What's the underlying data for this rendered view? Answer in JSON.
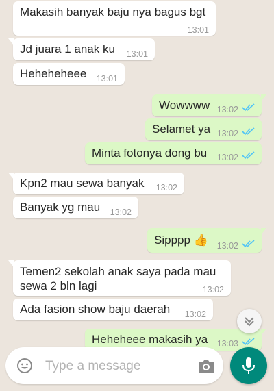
{
  "messages": [
    {
      "dir": "in",
      "text": "Makasih banyak baju nya bagus bgt",
      "time": "13:01"
    },
    {
      "dir": "in",
      "text": "Jd juara 1 anak ku",
      "time": "13:01"
    },
    {
      "dir": "in",
      "text": "Heheheheee",
      "time": "13:01"
    },
    {
      "dir": "out",
      "text": "Wowwww",
      "time": "13:02",
      "status": "read"
    },
    {
      "dir": "out",
      "text": "Selamet ya",
      "time": "13:02",
      "status": "read"
    },
    {
      "dir": "out",
      "text": "Minta fotonya dong bu",
      "time": "13:02",
      "status": "read"
    },
    {
      "dir": "in",
      "text": "Kpn2 mau sewa banyak",
      "time": "13:02"
    },
    {
      "dir": "in",
      "text": "Banyak yg mau",
      "time": "13:02"
    },
    {
      "dir": "out",
      "text": "Sipppp 👍",
      "time": "13:02",
      "status": "read"
    },
    {
      "dir": "in",
      "text": "Temen2 sekolah anak saya pada mau sewa 2 bln lagi",
      "time": "13:02"
    },
    {
      "dir": "in",
      "text": "Ada fasion show baju daerah",
      "time": "13:02"
    },
    {
      "dir": "out",
      "text": "Heheheee makasih ya",
      "time": "13:03",
      "status": "read"
    }
  ],
  "composer": {
    "placeholder": "Type a message"
  },
  "icons": {
    "emoji": "emoji-icon",
    "camera": "camera-icon",
    "mic": "microphone-icon",
    "scroll": "chevron-double-down-icon",
    "read": "double-check-icon"
  },
  "colors": {
    "background": "#ece5dd",
    "incoming": "#ffffff",
    "outgoing": "#dcf8c6",
    "read_ticks": "#4fc3f7",
    "fab": "#00897b"
  }
}
